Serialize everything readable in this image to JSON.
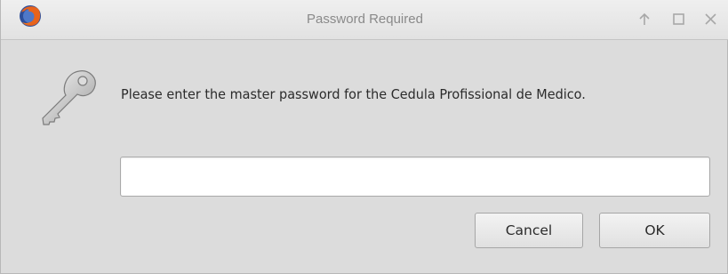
{
  "window": {
    "title": "Password Required",
    "app_icon": "firefox-icon",
    "controls": {
      "up_icon": "arrow-up-icon",
      "maximize_icon": "maximize-icon",
      "close_icon": "close-icon"
    }
  },
  "dialog": {
    "icon": "key-icon",
    "message": "Please enter the master password for the Cedula Profissional de Medico.",
    "password_value": "",
    "cancel_label": "Cancel",
    "ok_label": "OK"
  },
  "colors": {
    "background": "#dcdcdc",
    "title_text": "#8a8a8a",
    "body_text": "#2b2b2b",
    "input_background": "#ffffff"
  }
}
